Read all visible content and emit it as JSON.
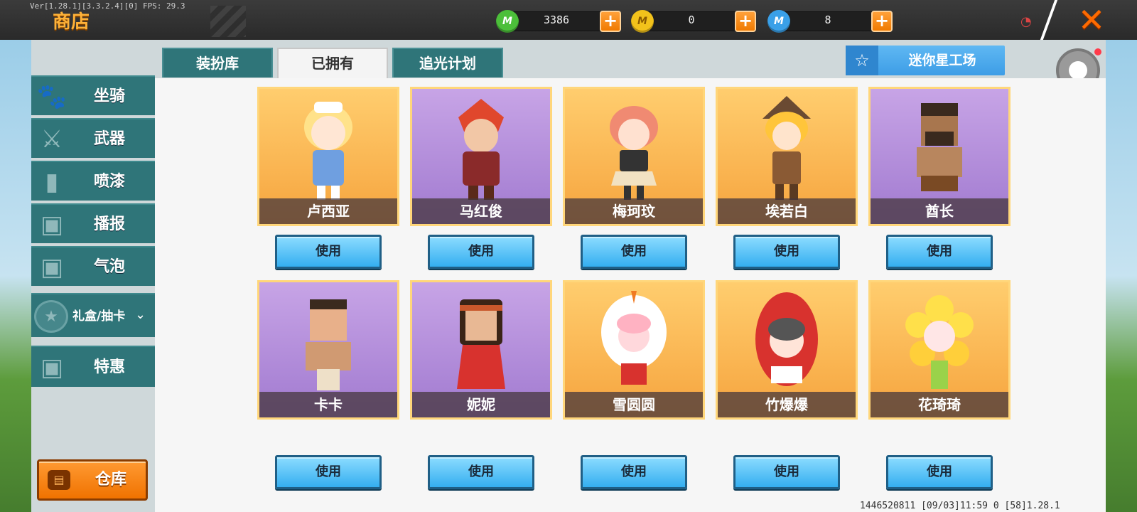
{
  "header": {
    "version_text": "Ver[1.28.1][3.3.2.4][0] FPS: 29.3",
    "title": "商店",
    "currencies": [
      {
        "icon": "green-mini-coin-icon",
        "symbol": "M",
        "amount": "3386",
        "color": "#4cbf3a"
      },
      {
        "icon": "gold-coin-icon",
        "symbol": "M",
        "amount": "0",
        "color": "#f2c21b"
      },
      {
        "icon": "blue-star-coin-icon",
        "symbol": "M",
        "amount": "8",
        "color": "#3aa0e8"
      }
    ],
    "plus_label": "+",
    "close_label": "✕"
  },
  "sidebar": {
    "items": [
      {
        "label": "坐骑",
        "icon": "mount-icon"
      },
      {
        "label": "武器",
        "icon": "weapon-icon"
      },
      {
        "label": "喷漆",
        "icon": "spray-icon"
      },
      {
        "label": "播报",
        "icon": "broadcast-icon"
      },
      {
        "label": "气泡",
        "icon": "bubble-icon"
      }
    ],
    "group": {
      "label": "礼盒/抽卡",
      "icon": "gift-icon",
      "chev": "⌄"
    },
    "special": {
      "label": "特惠",
      "icon": "deal-icon"
    },
    "warehouse": {
      "label": "仓库",
      "icon": "chest-icon"
    }
  },
  "tabs": [
    {
      "label": "装扮库",
      "active": false
    },
    {
      "label": "已拥有",
      "active": true
    },
    {
      "label": "追光计划",
      "active": false
    }
  ],
  "star_workshop": {
    "label": "迷你星工场",
    "icon": "star-icon"
  },
  "characters": [
    {
      "name": "卢西亚",
      "bg": "orange"
    },
    {
      "name": "马红俊",
      "bg": "purple"
    },
    {
      "name": "梅珂玟",
      "bg": "orange"
    },
    {
      "name": "埃若白",
      "bg": "orange"
    },
    {
      "name": "酋长",
      "bg": "purple"
    },
    {
      "name": "卡卡",
      "bg": "purple"
    },
    {
      "name": "妮妮",
      "bg": "purple"
    },
    {
      "name": "雪圆圆",
      "bg": "orange"
    },
    {
      "name": "竹爆爆",
      "bg": "orange"
    },
    {
      "name": "花琦琦",
      "bg": "orange"
    }
  ],
  "use_label": "使用",
  "footer": {
    "text": "1446520811   [09/03]11:59 0   [58]1.28.1"
  }
}
